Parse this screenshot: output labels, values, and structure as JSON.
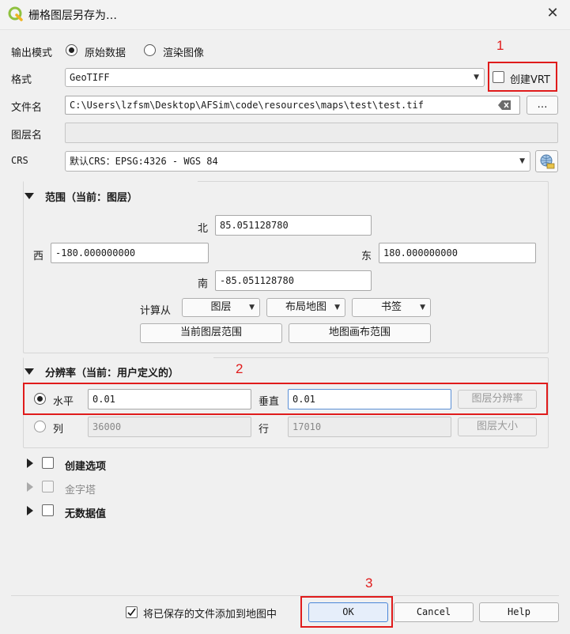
{
  "window": {
    "title": "栅格图层另存为…",
    "close_glyph": "✕"
  },
  "output_mode": {
    "label": "输出模式",
    "options": [
      "原始数据",
      "渲染图像"
    ],
    "selected": 0
  },
  "format": {
    "label": "格式",
    "value": "GeoTIFF",
    "create_vrt_label": "创建VRT"
  },
  "file_name": {
    "label": "文件名",
    "value": "C:\\Users\\lzfsm\\Desktop\\AFSim\\code\\resources\\maps\\test\\test.tif",
    "browse_label": "…"
  },
  "layer_name": {
    "label": "图层名",
    "value": ""
  },
  "crs": {
    "label": "CRS",
    "value": "默认CRS：EPSG:4326 - WGS 84"
  },
  "extent": {
    "title": "范围（当前：图层）",
    "north_label": "北",
    "north": "85.051128780",
    "west_label": "西",
    "west": "-180.000000000",
    "east_label": "东",
    "east": "180.000000000",
    "south_label": "南",
    "south": "-85.051128780",
    "calc_from_label": "计算从",
    "calc_buttons": [
      "图层",
      "布局地图",
      "书签"
    ],
    "current_layer_extent": "当前图层范围",
    "map_canvas_extent": "地图画布范围"
  },
  "resolution": {
    "title": "分辨率（当前：用户定义的）",
    "horizontal_label": "水平",
    "horizontal": "0.01",
    "vertical_label": "垂直",
    "vertical": "0.01",
    "layer_resolution_button": "图层分辨率",
    "columns_label": "列",
    "columns": "36000",
    "rows_label": "行",
    "rows": "17010",
    "layer_size_button": "图层大小"
  },
  "sections": {
    "create_options": "创建选项",
    "pyramids": "金字塔",
    "no_data": "无数据值"
  },
  "footer": {
    "add_to_map_label": "将已保存的文件添加到地图中",
    "ok": "OK",
    "cancel": "Cancel",
    "help": "Help"
  },
  "annotations": {
    "num1": "1",
    "num2": "2",
    "num3": "3"
  },
  "colors": {
    "annotation_red": "#e01b1b",
    "qgis_green": "#8fc13f",
    "qgis_yellow": "#f0b323"
  }
}
